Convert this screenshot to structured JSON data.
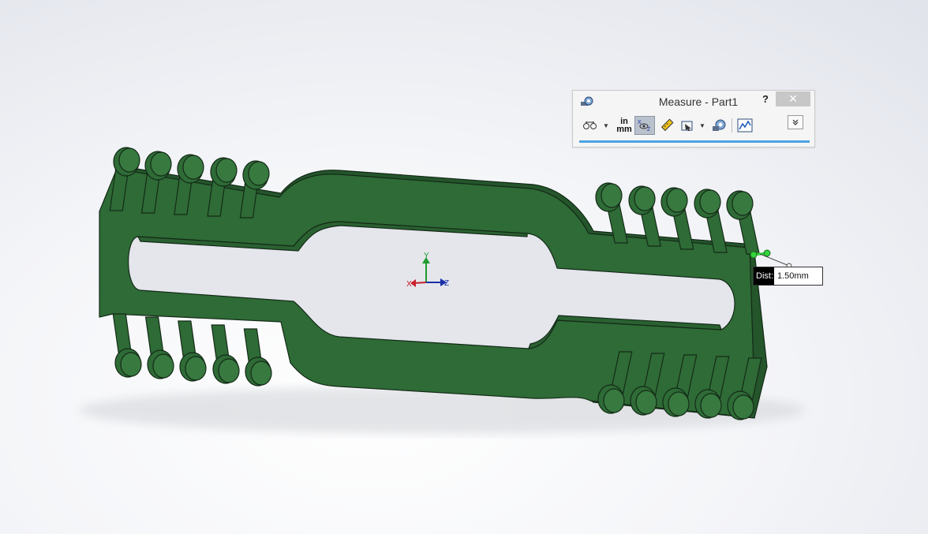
{
  "window": {
    "title": "Measure - Part1"
  },
  "dialog": {
    "help_label": "?",
    "close_label": "✕",
    "units_top": "in",
    "units_bottom": "mm"
  },
  "callout": {
    "label": "Dist:",
    "value": "1.50mm"
  },
  "triad": {
    "y_label": "Y",
    "x_label": "X",
    "z_label": "Z"
  },
  "colors": {
    "part_green": "#2e6b36",
    "part_edge": "#1c3b20",
    "selected_edge": "#34d23c",
    "accent_blue": "#4aa3e0"
  },
  "icons": [
    "measure-tape-icon",
    "arc-circle-options-icon",
    "units-precision-icon",
    "show-xyz-icon",
    "point-to-point-icon",
    "projection-icon",
    "history-icon",
    "sensor-icon",
    "collapse-icon"
  ]
}
